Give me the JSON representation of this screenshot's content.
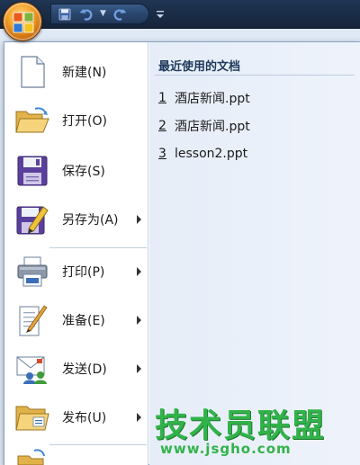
{
  "app": {
    "orb_icon": "office-orb-icon",
    "quick_access": [
      {
        "name": "save-icon"
      },
      {
        "name": "undo-icon"
      },
      {
        "name": "redo-icon"
      }
    ]
  },
  "menu": {
    "items": [
      {
        "label": "新建(N)",
        "icon": "new-document-icon",
        "submenu": false
      },
      {
        "label": "打开(O)",
        "icon": "open-folder-icon",
        "submenu": false
      },
      {
        "label": "保存(S)",
        "icon": "save-icon",
        "submenu": false
      },
      {
        "label": "另存为(A)",
        "icon": "save-as-icon",
        "submenu": true
      },
      {
        "label": "打印(P)",
        "icon": "printer-icon",
        "submenu": true
      },
      {
        "label": "准备(E)",
        "icon": "prepare-icon",
        "submenu": true
      },
      {
        "label": "发送(D)",
        "icon": "send-icon",
        "submenu": true
      },
      {
        "label": "发布(U)",
        "icon": "publish-icon",
        "submenu": true
      }
    ]
  },
  "recent": {
    "title": "最近使用的文档",
    "files": [
      {
        "num": "1",
        "name": "酒店新闻.ppt"
      },
      {
        "num": "2",
        "name": "酒店新闻.ppt"
      },
      {
        "num": "3",
        "name": "lesson2.ppt"
      }
    ]
  },
  "watermark": {
    "title": "技术员联盟",
    "url": "www.jsgho.com"
  },
  "colors": {
    "accent": "#1e395b",
    "watermark": "#31b34a",
    "orb": "#f3a32b"
  }
}
